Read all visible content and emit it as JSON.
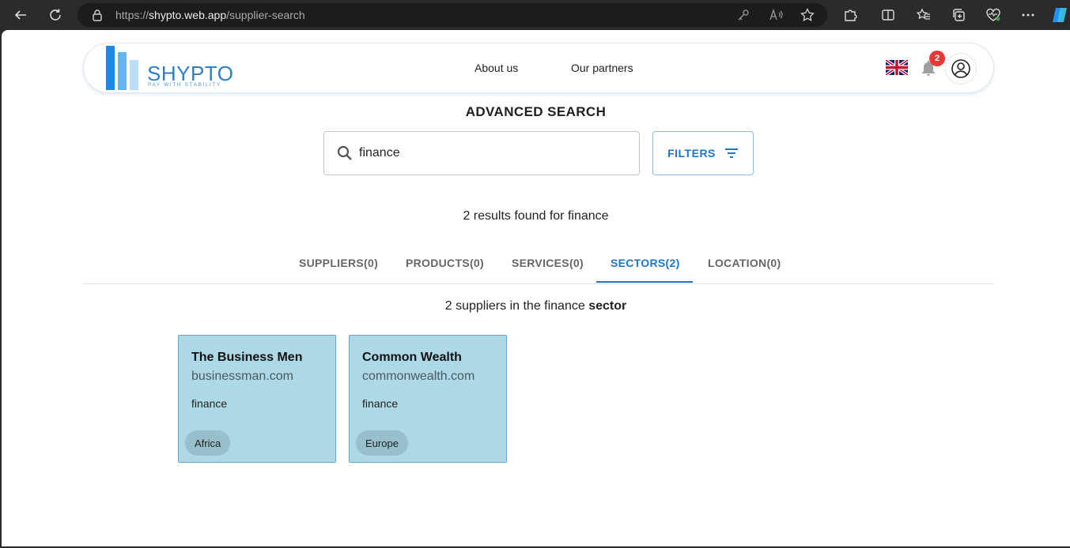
{
  "browser": {
    "url_prefix": "https://",
    "url_host": "shypto.web.app",
    "url_path": "/supplier-search"
  },
  "header": {
    "logo_text": "SHYPTO",
    "logo_tagline": "PAY WITH STABILITY",
    "nav": [
      "About us",
      "Our partners"
    ],
    "notification_count": "2"
  },
  "search": {
    "title": "ADVANCED SEARCH",
    "query": "finance",
    "filters_label": "FILTERS",
    "results_text": "2 results found for finance"
  },
  "tabs": [
    {
      "label": "SUPPLIERS(0)",
      "active": false
    },
    {
      "label": "PRODUCTS(0)",
      "active": false
    },
    {
      "label": "SERVICES(0)",
      "active": false
    },
    {
      "label": "SECTORS(2)",
      "active": true
    },
    {
      "label": "LOCATION(0)",
      "active": false
    }
  ],
  "section": {
    "text": "2 suppliers in the finance ",
    "emphasis": "sector"
  },
  "suppliers": [
    {
      "name": "The Business Men",
      "domain": "businessman.com",
      "sector": "finance",
      "region": "Africa"
    },
    {
      "name": "Common Wealth",
      "domain": "commonwealth.com",
      "sector": "finance",
      "region": "Europe"
    }
  ],
  "colors": {
    "accent": "#1976d2",
    "card_bg": "#add8e6",
    "card_border": "#5aa7e8",
    "chip_bg": "#97bfcc",
    "badge": "#e53935"
  }
}
